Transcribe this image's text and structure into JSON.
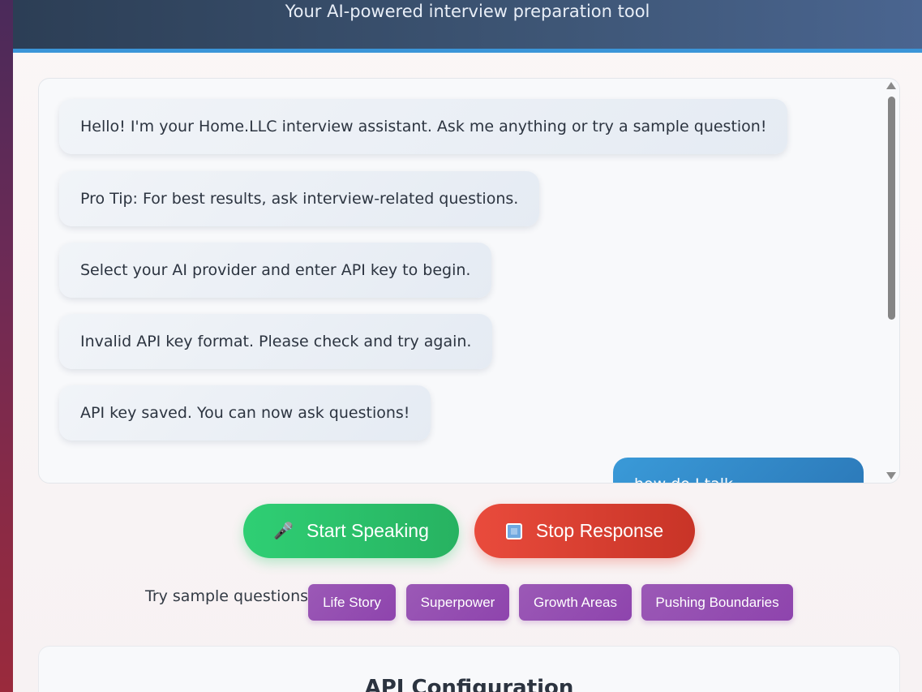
{
  "header": {
    "subtitle": "Your AI-powered interview preparation tool"
  },
  "chat": {
    "messages": [
      {
        "role": "assistant",
        "text": "Hello! I'm your Home.LLC interview assistant. Ask me anything or try a sample question!"
      },
      {
        "role": "assistant",
        "text": "Pro Tip: For best results, ask interview-related questions."
      },
      {
        "role": "assistant",
        "text": "Select your AI provider and enter API key to begin."
      },
      {
        "role": "assistant",
        "text": "Invalid API key format. Please check and try again."
      },
      {
        "role": "assistant",
        "text": "API key saved. You can now ask questions!"
      },
      {
        "role": "user",
        "text": "how do I talk...(partially visible)"
      }
    ]
  },
  "controls": {
    "start_label": "Start Speaking",
    "stop_label": "Stop Response",
    "start_icon": "microphone-icon",
    "stop_icon": "stop-square-icon"
  },
  "samples": {
    "label": "Try sample questions:",
    "chips": [
      "Life Story",
      "Superpower",
      "Growth Areas",
      "Pushing Boundaries"
    ]
  },
  "config": {
    "title": "API Configuration"
  },
  "colors": {
    "header_bg": "#34495e",
    "header_border": "#3b95d8",
    "start_button": "#2ecc71",
    "stop_button": "#e74c3c",
    "chip": "#9b59b6",
    "user_bubble": "#3498db"
  }
}
